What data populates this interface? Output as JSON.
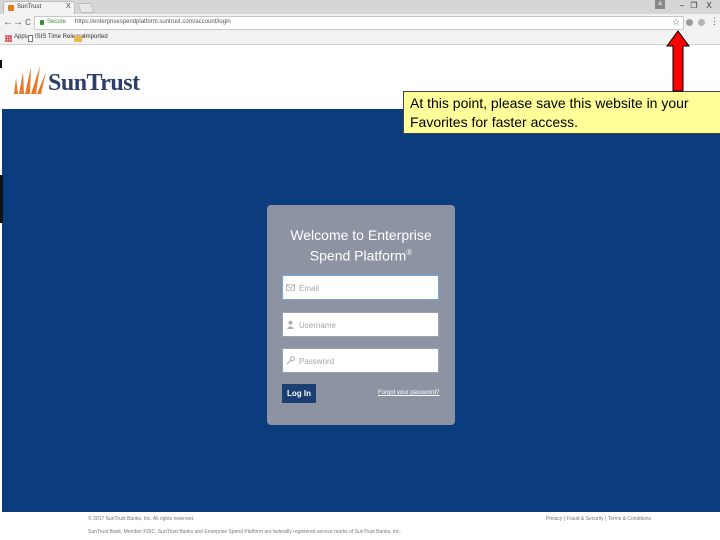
{
  "browser": {
    "tab_title": "SunTrust",
    "tab_close": "X",
    "user_badge": "a",
    "win_min": "–",
    "win_restore": "❐",
    "win_close": "X",
    "back": "←",
    "forward": "→",
    "reload": "C",
    "secure_label": "Secure",
    "url": "https://enterprisespendplatform.suntrust.com/account/login",
    "menu": "⋮",
    "bookmarks": {
      "apps": "Apps",
      "isis_time_release": "ISIS Time Release",
      "imported": "Imported"
    }
  },
  "page": {
    "brand": "SunTrust",
    "welcome_line1": "Welcome to Enterprise",
    "welcome_line2": "Spend Platform",
    "registered": "®",
    "email_placeholder": "Email",
    "username_placeholder": "Username",
    "password_placeholder": "Password",
    "login_label": "Log In",
    "forgot_label": "Forgot your password?",
    "footer_copy": "© 2017 SunTrust Banks, Inc. All rights reserved.",
    "footer_legal": "SunTrust Bank, Member FDIC. SunTrust Banks and Enterprise Spend Platform are federally registered service marks of SunTrust Banks, Inc.",
    "footer_links": "Privacy | Fraud & Security | Terms & Conditions"
  },
  "annotation": {
    "text": "At this point, please save this website in your Favorites for faster access."
  },
  "colors": {
    "hero_blue": "#0a3c7e",
    "card_gray": "#8d93a3",
    "callout_yellow": "#ffff99",
    "arrow_red": "#ff0000"
  }
}
